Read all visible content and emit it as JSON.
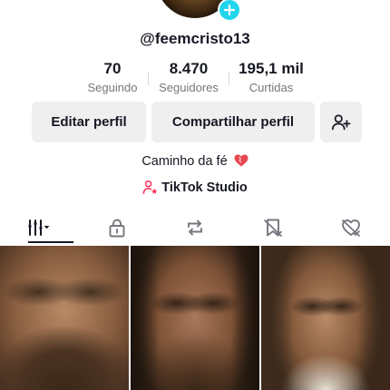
{
  "profile": {
    "username": "@feemcristo13",
    "bio": "Caminho da fé"
  },
  "stats": [
    {
      "value": "70",
      "label": "Seguindo"
    },
    {
      "value": "8.470",
      "label": "Seguidores"
    },
    {
      "value": "195,1 mil",
      "label": "Curtidas"
    }
  ],
  "actions": {
    "edit_label": "Editar perfil",
    "share_label": "Compartilhar perfil"
  },
  "studio": {
    "label": "TikTok Studio"
  },
  "tabs": [
    {
      "icon": "grid-filter-icon",
      "active": true
    },
    {
      "icon": "lock-icon",
      "active": false
    },
    {
      "icon": "repost-icon",
      "active": false
    },
    {
      "icon": "bookmark-icon",
      "active": false
    },
    {
      "icon": "liked-heart-icon",
      "active": false
    }
  ],
  "colors": {
    "accent_badge": "#20d5ec",
    "text_primary": "#161823",
    "text_secondary": "#75777d",
    "button_bg": "#efeff0",
    "heart": "#e8484f",
    "studio_icon": "#fe2c55"
  }
}
